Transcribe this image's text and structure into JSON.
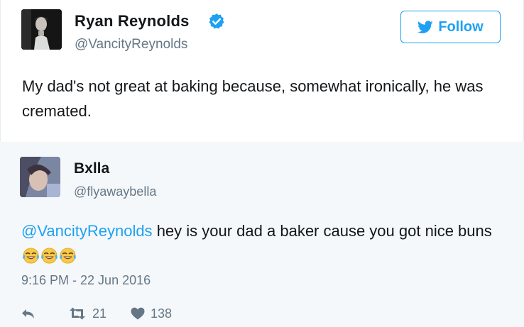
{
  "original_tweet": {
    "name": "Ryan Reynolds",
    "handle": "@VancityReynolds",
    "text": "My dad's not great at baking because, somewhat ironically, he was cremated.",
    "verified": true,
    "follow_label": "Follow"
  },
  "reply": {
    "name": "Bxlla",
    "handle": "@flyawaybella",
    "mention": "@VancityReynolds",
    "text": "hey is your dad a baker cause you got nice buns",
    "emojis": [
      "face-with-tears-of-joy-icon",
      "face-with-tears-of-joy-icon",
      "face-with-tears-of-joy-icon"
    ],
    "timestamp": "9:16 PM - 22 Jun 2016",
    "retweet_count": "21",
    "like_count": "138"
  },
  "colors": {
    "accent": "#1da1f2",
    "secondary_text": "#657786",
    "reply_background": "#f5f8fa"
  }
}
